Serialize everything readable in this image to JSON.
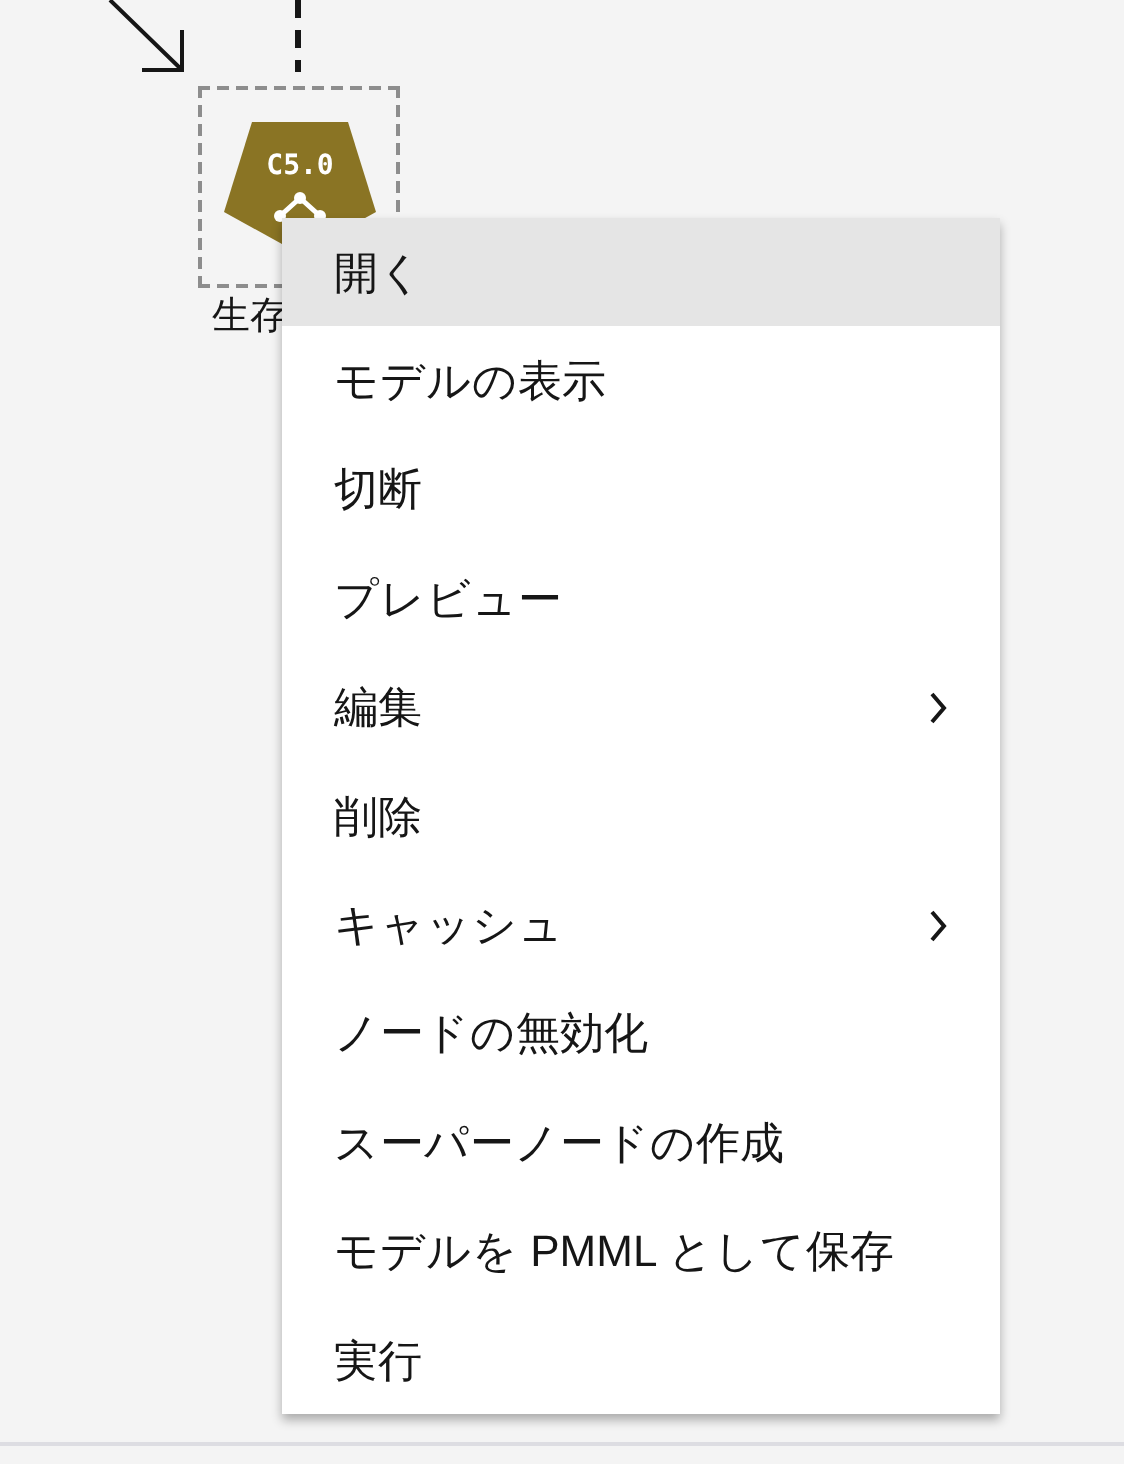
{
  "node": {
    "badge": "C5.0",
    "label": "生存",
    "selected": true
  },
  "context_menu": {
    "items": [
      {
        "label": "開く",
        "selected": true,
        "submenu": false
      },
      {
        "label": "モデルの表示",
        "selected": false,
        "submenu": false
      },
      {
        "label": "切断",
        "selected": false,
        "submenu": false
      },
      {
        "label": "プレビュー",
        "selected": false,
        "submenu": false
      },
      {
        "label": "編集",
        "selected": false,
        "submenu": true
      },
      {
        "label": "削除",
        "selected": false,
        "submenu": false
      },
      {
        "label": "キャッシュ",
        "selected": false,
        "submenu": true
      },
      {
        "label": "ノードの無効化",
        "selected": false,
        "submenu": false
      },
      {
        "label": "スーパーノードの作成",
        "selected": false,
        "submenu": false
      },
      {
        "label": "モデルを PMML として保存",
        "selected": false,
        "submenu": false
      },
      {
        "label": "実行",
        "selected": false,
        "submenu": false
      }
    ]
  }
}
